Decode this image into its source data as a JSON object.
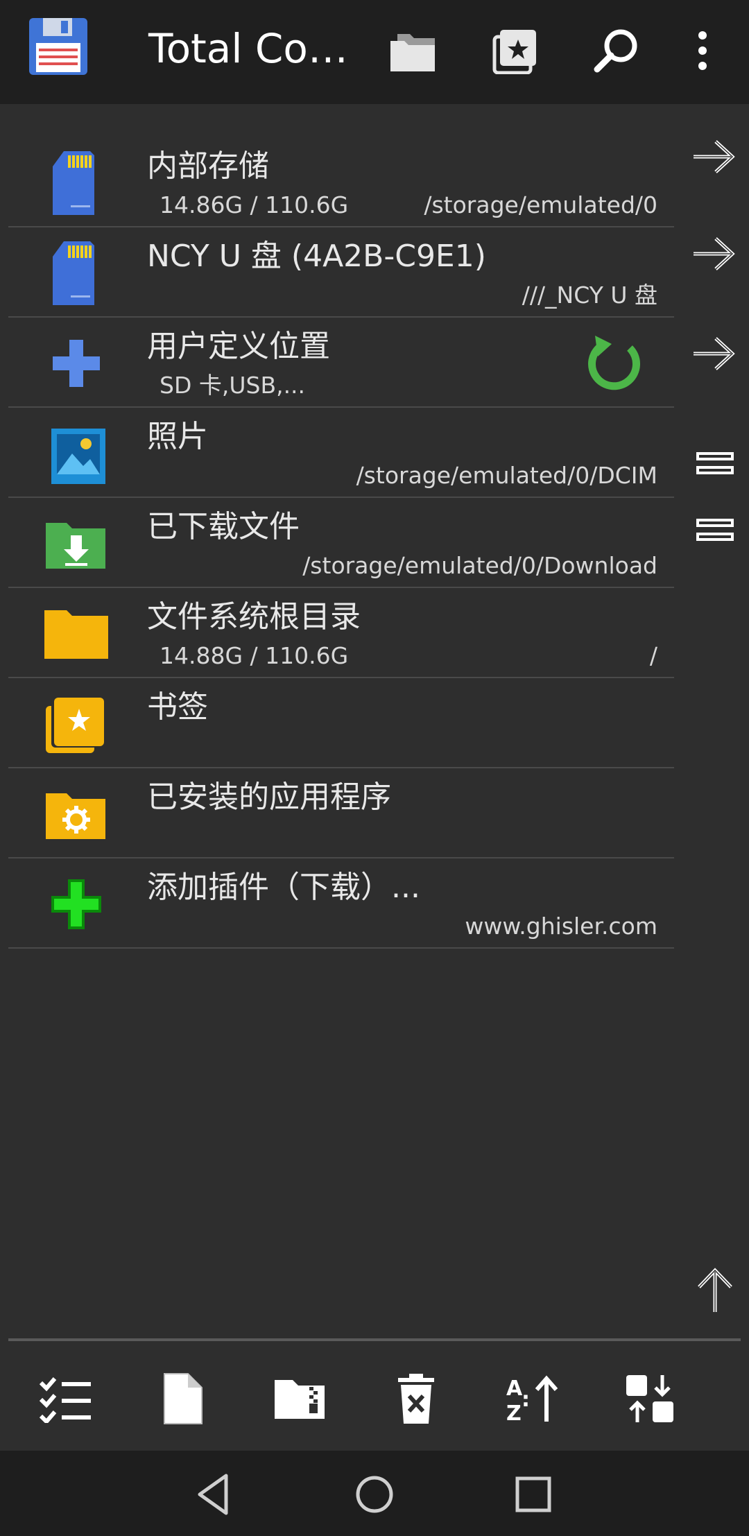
{
  "app": {
    "title": "Total Co…"
  },
  "items": [
    {
      "name": "内部存储",
      "size": "14.86G / 110.6G",
      "path": "/storage/emulated/0",
      "icon": "sd-card-icon"
    },
    {
      "name": "NCY U 盘 (4A2B-C9E1)",
      "size": "",
      "path": "///_NCY U 盘",
      "icon": "sd-card-icon"
    },
    {
      "name": "用户定义位置",
      "size": "SD 卡,USB,...",
      "path": "",
      "icon": "plus-icon"
    },
    {
      "name": "照片",
      "size": "",
      "path": "/storage/emulated/0/DCIM",
      "icon": "image-icon"
    },
    {
      "name": "已下载文件",
      "size": "",
      "path": "/storage/emulated/0/Download",
      "icon": "download-folder-icon"
    },
    {
      "name": "文件系统根目录",
      "size": "14.88G / 110.6G",
      "path": "/",
      "icon": "folder-icon"
    },
    {
      "name": "书签",
      "size": "",
      "path": "",
      "icon": "bookmark-folder-icon"
    },
    {
      "name": "已安装的应用程序",
      "size": "",
      "path": "",
      "icon": "app-folder-icon"
    },
    {
      "name": "添加插件（下载）...",
      "size": "",
      "path": "www.ghisler.com",
      "icon": "green-plus-icon"
    }
  ],
  "colors": {
    "appbar": "#1f1f1f",
    "background": "#2e2e2e",
    "sd_blue": "#3f6fd8",
    "folder_yellow": "#f5b50c",
    "download_green": "#4caf50",
    "refresh_green": "#4cb648"
  }
}
